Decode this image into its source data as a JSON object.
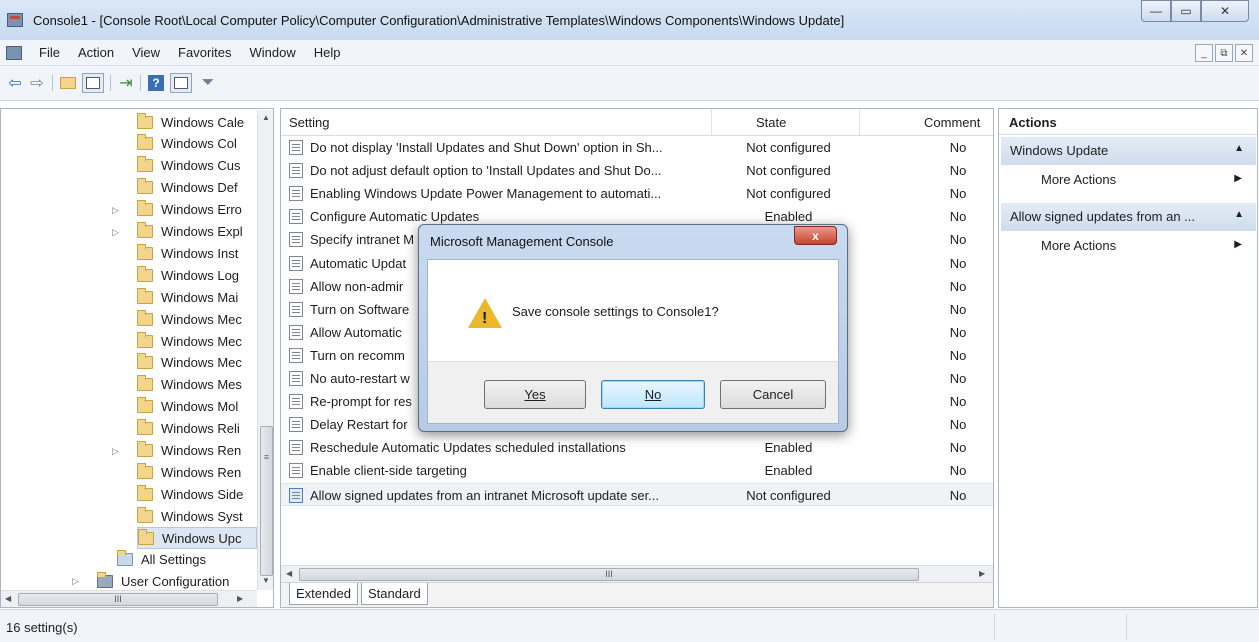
{
  "window": {
    "title": "Console1 - [Console Root\\Local Computer Policy\\Computer Configuration\\Administrative Templates\\Windows Components\\Windows Update]",
    "min_label": "—",
    "max_label": "▭",
    "close_label": "✕"
  },
  "menu": {
    "items": [
      "File",
      "Action",
      "View",
      "Favorites",
      "Window",
      "Help"
    ],
    "mdi_min": "_",
    "mdi_restore": "⧉",
    "mdi_close": "✕"
  },
  "toolbar": {
    "icons": [
      "back-icon",
      "forward-icon",
      "up-folder-icon",
      "show-tree-icon",
      "export-icon",
      "help-icon",
      "action-pane-icon",
      "filter-icon"
    ]
  },
  "tree": {
    "items": [
      {
        "label": "Windows Cale"
      },
      {
        "label": "Windows Col"
      },
      {
        "label": "Windows Cus"
      },
      {
        "label": "Windows Def"
      },
      {
        "label": "Windows Erro",
        "expandable": true
      },
      {
        "label": "Windows Expl",
        "expandable": true
      },
      {
        "label": "Windows Inst"
      },
      {
        "label": "Windows Log"
      },
      {
        "label": "Windows Mai"
      },
      {
        "label": "Windows Mec"
      },
      {
        "label": "Windows Mec"
      },
      {
        "label": "Windows Mec"
      },
      {
        "label": "Windows Mes"
      },
      {
        "label": "Windows Mol"
      },
      {
        "label": "Windows Reli"
      },
      {
        "label": "Windows Ren",
        "expandable": true
      },
      {
        "label": "Windows Ren"
      },
      {
        "label": "Windows Side"
      },
      {
        "label": "Windows Syst"
      },
      {
        "label": "Windows Upc",
        "selected": true
      }
    ],
    "all_settings": "All Settings",
    "user_config": "User Configuration",
    "scroll_mid": "≡",
    "hscroll_mid": "III"
  },
  "list": {
    "columns": {
      "setting": "Setting",
      "state": "State",
      "comment": "Comment"
    },
    "rows": [
      {
        "name": "Do not display 'Install Updates and Shut Down' option in Sh...",
        "state": "Not configured",
        "comment": "No"
      },
      {
        "name": "Do not adjust default option to 'Install Updates and Shut Do...",
        "state": "Not configured",
        "comment": "No"
      },
      {
        "name": "Enabling Windows Update Power Management to automati...",
        "state": "Not configured",
        "comment": "No"
      },
      {
        "name": "Configure Automatic Updates",
        "state": "Enabled",
        "comment": "No"
      },
      {
        "name": "Specify intranet M",
        "state": "",
        "comment": "No"
      },
      {
        "name": "Automatic Updat",
        "state": "",
        "comment": "No"
      },
      {
        "name": "Allow non-admir",
        "state": "",
        "comment": "No"
      },
      {
        "name": "Turn on Software",
        "state": "",
        "comment": "No"
      },
      {
        "name": "Allow Automatic",
        "state": "",
        "comment": "No"
      },
      {
        "name": "Turn on recomm",
        "state": "",
        "comment": "No"
      },
      {
        "name": "No auto-restart w",
        "state": "",
        "comment": "No"
      },
      {
        "name": "Re-prompt for res",
        "state": "",
        "comment": "No"
      },
      {
        "name": "Delay Restart for",
        "state": "",
        "comment": "No"
      },
      {
        "name": "Reschedule Automatic Updates scheduled installations",
        "state": "Enabled",
        "comment": "No"
      },
      {
        "name": "Enable client-side targeting",
        "state": "Enabled",
        "comment": "No"
      },
      {
        "name": "Allow signed updates from an intranet Microsoft update ser...",
        "state": "Not configured",
        "comment": "No",
        "highlight": true
      }
    ],
    "hscroll_mid": "III",
    "tabs": [
      "Extended",
      "Standard"
    ]
  },
  "actions": {
    "header": "Actions",
    "sections": [
      {
        "title": "Windows Update",
        "item": "More Actions"
      },
      {
        "title": "Allow signed updates from an ...",
        "item": "More Actions"
      }
    ]
  },
  "status": {
    "text": "16 setting(s)"
  },
  "dialog": {
    "title": "Microsoft Management Console",
    "close_label": "x",
    "message": "Save console settings to Console1?",
    "yes": "Yes",
    "no": "No",
    "cancel": "Cancel"
  }
}
